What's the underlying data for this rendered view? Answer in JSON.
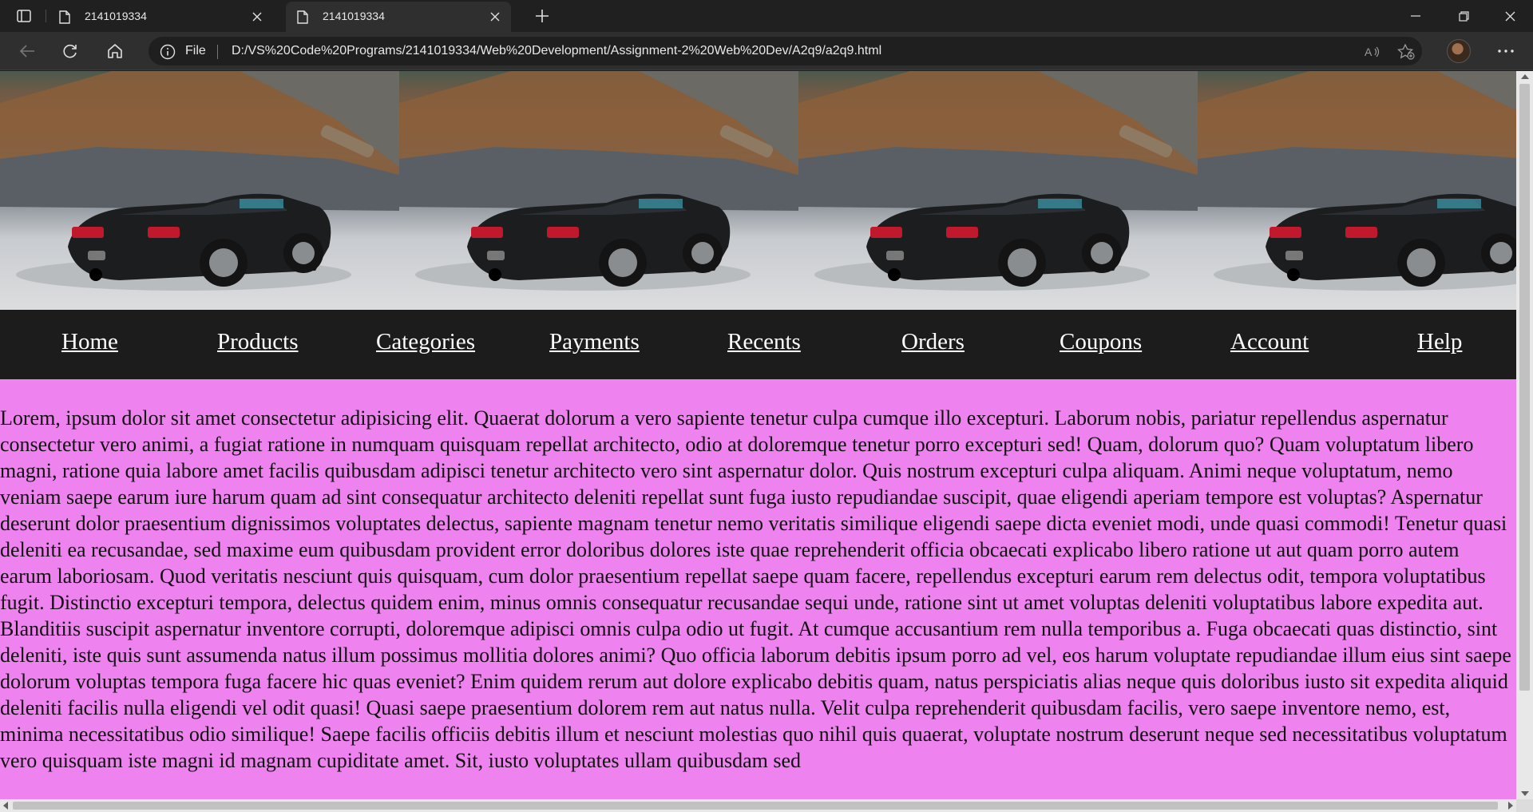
{
  "browser": {
    "tabs": [
      {
        "title": "2141019334",
        "active": false
      },
      {
        "title": "2141019334",
        "active": true
      }
    ],
    "address": {
      "scheme_label": "File",
      "url": "D:/VS%20Code%20Programs/2141019334/Web%20Development/Assignment-2%20Web%20Dev/A2q9/a2q9.html"
    },
    "icons": {
      "tab_actions": "tab-actions-icon",
      "doc": "document-icon",
      "new_tab": "plus-icon",
      "back": "back-arrow-icon",
      "refresh": "refresh-icon",
      "home": "home-icon",
      "info": "info-icon",
      "read_aloud": "read-aloud-icon",
      "favorites": "add-favorite-icon",
      "more": "more-icon"
    }
  },
  "page": {
    "banner": {
      "image_count": 4,
      "image_subject": "black convertible sports car on gravel"
    },
    "nav": [
      {
        "label": "Home"
      },
      {
        "label": "Products"
      },
      {
        "label": "Categories"
      },
      {
        "label": "Payments"
      },
      {
        "label": "Recents"
      },
      {
        "label": "Orders"
      },
      {
        "label": "Coupons"
      },
      {
        "label": "Account"
      },
      {
        "label": "Help"
      }
    ],
    "paragraph": "Lorem, ipsum dolor sit amet consectetur adipisicing elit. Quaerat dolorum a vero sapiente tenetur culpa cumque illo excepturi. Laborum nobis, pariatur repellendus aspernatur consectetur vero animi, a fugiat ratione in numquam quisquam repellat architecto, odio at doloremque tenetur porro excepturi sed! Quam, dolorum quo? Quam voluptatum libero magni, ratione quia labore amet facilis quibusdam adipisci tenetur architecto vero sint aspernatur dolor. Quis nostrum excepturi culpa aliquam. Animi neque voluptatum, nemo veniam saepe earum iure harum quam ad sint consequatur architecto deleniti repellat sunt fuga iusto repudiandae suscipit, quae eligendi aperiam tempore est voluptas? Aspernatur deserunt dolor praesentium dignissimos voluptates delectus, sapiente magnam tenetur nemo veritatis similique eligendi saepe dicta eveniet modi, unde quasi commodi! Tenetur quasi deleniti ea recusandae, sed maxime eum quibusdam provident error doloribus dolores iste quae reprehenderit officia obcaecati explicabo libero ratione ut aut quam porro autem earum laboriosam. Quod veritatis nesciunt quis quisquam, cum dolor praesentium repellat saepe quam facere, repellendus excepturi earum rem delectus odit, tempora voluptatibus fugit. Distinctio excepturi tempora, delectus quidem enim, minus omnis consequatur recusandae sequi unde, ratione sint ut amet voluptas deleniti voluptatibus labore expedita aut. Blanditiis suscipit aspernatur inventore corrupti, doloremque adipisci omnis culpa odio ut fugit. At cumque accusantium rem nulla temporibus a. Fuga obcaecati quas distinctio, sint deleniti, iste quis sunt assumenda natus illum possimus mollitia dolores animi? Quo officia laborum debitis ipsum porro ad vel, eos harum voluptate repudiandae illum eius sint saepe dolorum voluptas tempora fuga facere hic quas eveniet? Enim quidem rerum aut dolore explicabo debitis quam, natus perspiciatis alias neque quis doloribus iusto sit expedita aliquid deleniti facilis nulla eligendi vel odit quasi! Quasi saepe praesentium dolorem rem aut natus nulla. Velit culpa reprehenderit quibusdam facilis, vero saepe inventore nemo, est, minima necessitatibus odio similique! Saepe facilis officiis debitis illum et nesciunt molestias quo nihil quis quaerat, voluptate nostrum deserunt neque sed necessitatibus voluptatum vero quisquam iste magni id magnam cupiditate amet. Sit, iusto voluptates ullam quibusdam sed",
    "colors": {
      "page_background": "#ee82ee",
      "nav_background": "#1c1c1c",
      "nav_text": "#ffffff"
    }
  }
}
